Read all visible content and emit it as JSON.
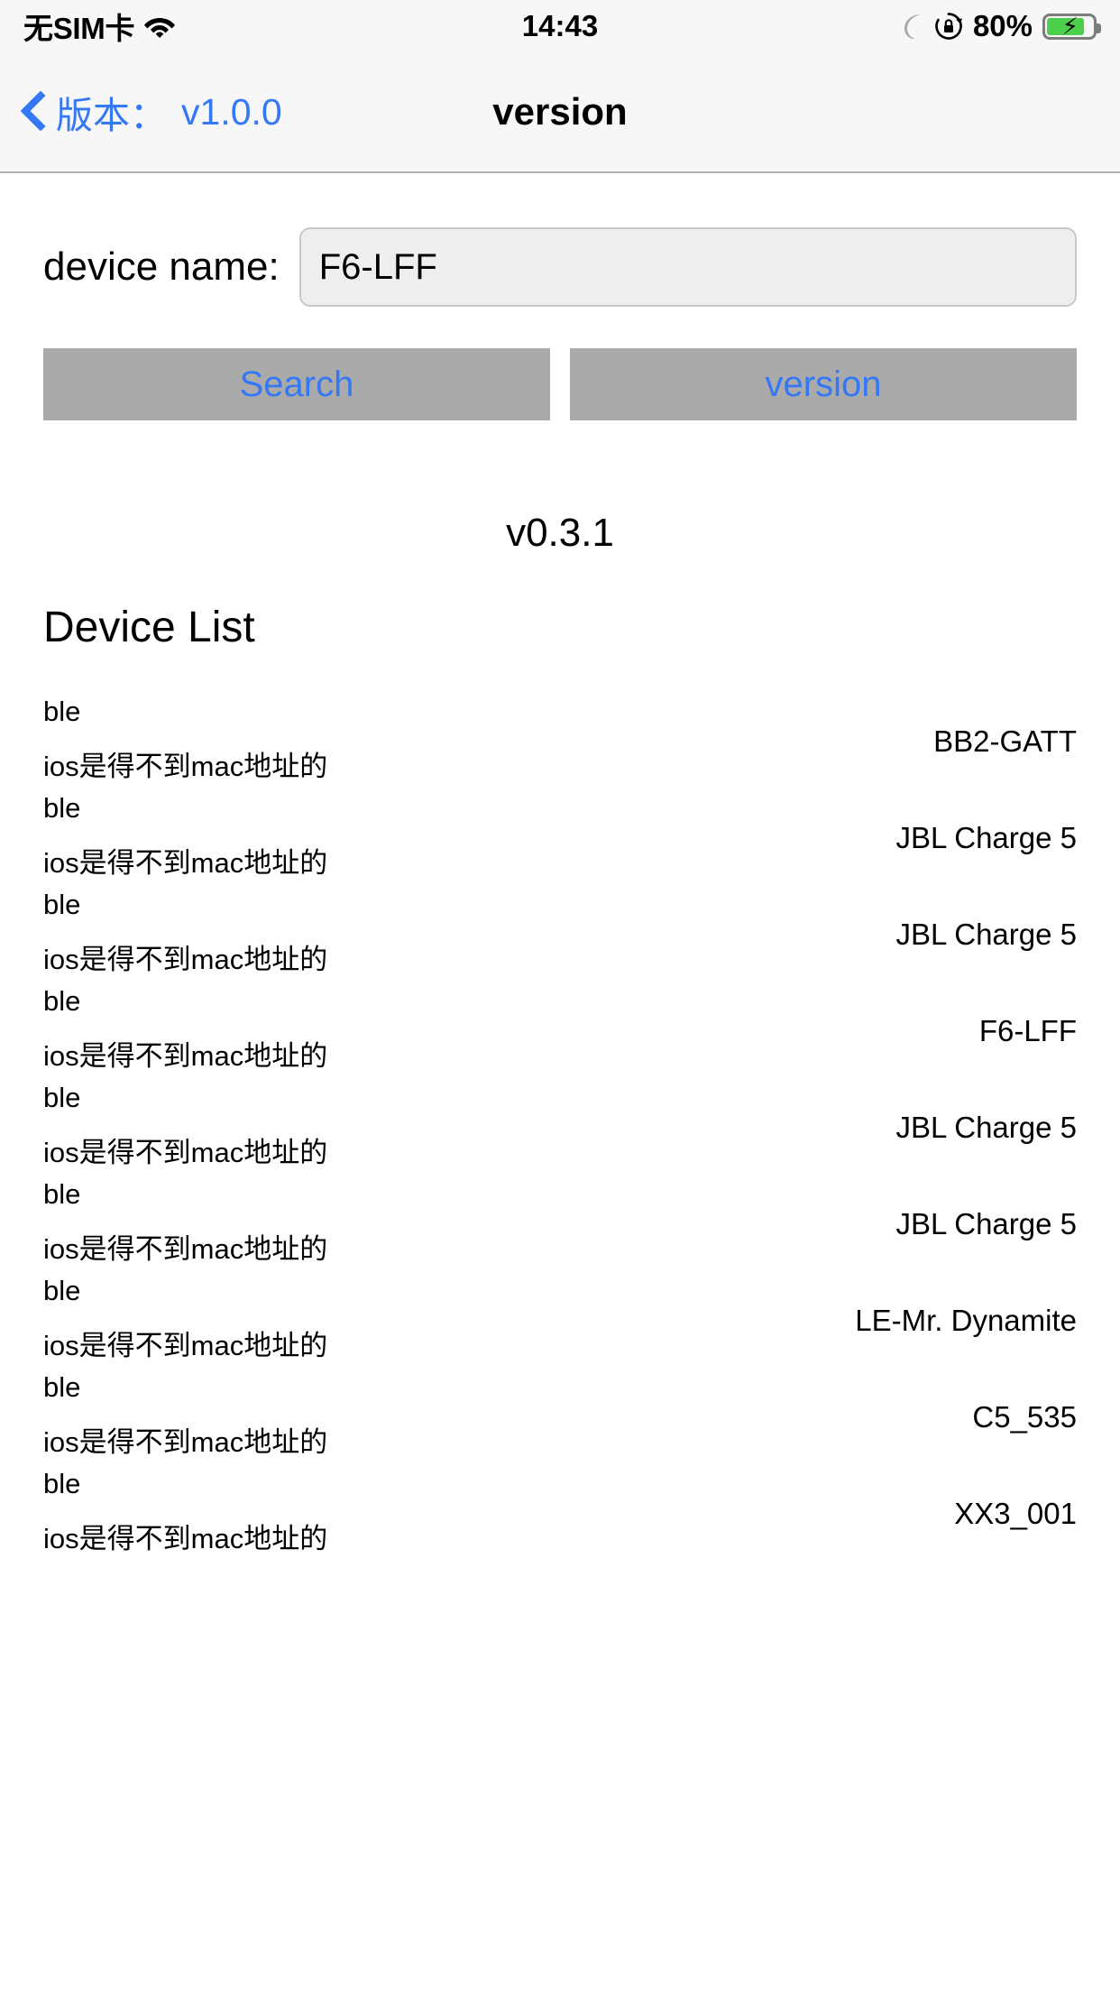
{
  "status_bar": {
    "carrier": "无SIM卡",
    "wifi_icon": "wifi-icon",
    "time": "14:43",
    "dnd_icon": "moon-icon",
    "rotation_lock_icon": "rotation-lock-icon",
    "battery_percent": "80%",
    "battery_icon": "battery-charging-icon"
  },
  "nav_bar": {
    "back_icon": "chevron-left-icon",
    "back_label": "版本：",
    "back_version": "v1.0.0",
    "title": "version"
  },
  "form": {
    "device_name_label": "device name:",
    "device_name_value": "F6-LFF",
    "device_name_placeholder": "device name"
  },
  "buttons": {
    "search_label": "Search",
    "version_label": "version"
  },
  "firmware_version": "v0.3.1",
  "device_list": {
    "heading": "Device List",
    "rows": [
      {
        "type": "ble",
        "note": "ios是得不到mac地址的",
        "name": "BB2-GATT"
      },
      {
        "type": "ble",
        "note": "ios是得不到mac地址的",
        "name": "JBL Charge 5"
      },
      {
        "type": "ble",
        "note": "ios是得不到mac地址的",
        "name": "JBL Charge 5"
      },
      {
        "type": "ble",
        "note": "ios是得不到mac地址的",
        "name": "F6-LFF"
      },
      {
        "type": "ble",
        "note": "ios是得不到mac地址的",
        "name": "JBL Charge 5"
      },
      {
        "type": "ble",
        "note": "ios是得不到mac地址的",
        "name": "JBL Charge 5"
      },
      {
        "type": "ble",
        "note": "ios是得不到mac地址的",
        "name": "LE-Mr. Dynamite"
      },
      {
        "type": "ble",
        "note": "ios是得不到mac地址的",
        "name": "C5_535"
      },
      {
        "type": "ble",
        "note": "ios是得不到mac地址的",
        "name": "XX3_001"
      }
    ]
  },
  "colors": {
    "accent_blue": "#3478f6",
    "button_gray": "#aaaaaa",
    "bar_bg": "#f7f7f7",
    "input_bg": "#eeeeee",
    "battery_green": "#4cd04c"
  }
}
